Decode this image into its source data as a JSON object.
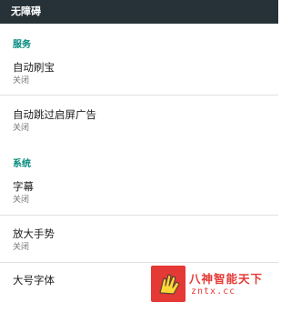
{
  "app_bar": {
    "title": "无障碍"
  },
  "sections": {
    "services": {
      "header": "服务",
      "items": [
        {
          "title": "自动刷宝",
          "summary": "关闭"
        },
        {
          "title": "自动跳过启屏广告",
          "summary": "关闭"
        }
      ]
    },
    "system": {
      "header": "系统",
      "items": [
        {
          "title": "字幕",
          "summary": "关闭"
        },
        {
          "title": "放大手势",
          "summary": "关闭"
        },
        {
          "title": "大号字体"
        }
      ]
    }
  },
  "watermark": {
    "name": "八神智能天下",
    "url": "zntx.cc",
    "color": "#e53935",
    "icon": "hand-logo-icon"
  },
  "colors": {
    "app_bar": "#263238",
    "accent": "#00897b"
  }
}
